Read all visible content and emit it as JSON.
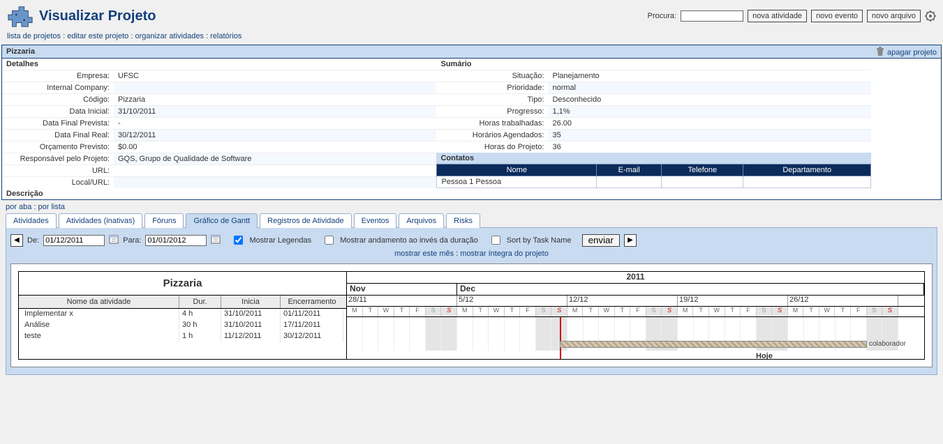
{
  "header": {
    "title": "Visualizar Projeto",
    "search_label": "Procura:",
    "new_activity": "nova atividade",
    "new_event": "novo evento",
    "new_file": "novo arquivo"
  },
  "breadcrumb": {
    "projects": "lista de projetos",
    "edit": "editar este projeto",
    "organize": "organizar atividades",
    "reports": "relatórios"
  },
  "project": {
    "name": "Pizzaria",
    "delete_label": "apagar projeto",
    "details_head": "Detalhes",
    "summary_head": "Sumário",
    "contacts_head": "Contatos",
    "description_head": "Descrição",
    "details": {
      "empresa_l": "Empresa:",
      "empresa_v": "UFSC",
      "internal_l": "Internal Company:",
      "internal_v": "",
      "codigo_l": "Código:",
      "codigo_v": "Pizzaria",
      "inicio_l": "Data Inicial:",
      "inicio_v": "31/10/2011",
      "prevista_l": "Data Final Prevista:",
      "prevista_v": "-",
      "real_l": "Data Final Real:",
      "real_v": "30/12/2011",
      "orc_l": "Orçamento Previsto:",
      "orc_v": "$0.00",
      "resp_l": "Responsável pelo Projeto:",
      "resp_v": "GQS, Grupo de Qualidade de Software",
      "url_l": "URL:",
      "url_v": "",
      "local_l": "Local/URL:",
      "local_v": ""
    },
    "summary": {
      "sit_l": "Situação:",
      "sit_v": "Planejamento",
      "pri_l": "Prioridade:",
      "pri_v": "normal",
      "tipo_l": "Tipo:",
      "tipo_v": "Desconhecido",
      "prog_l": "Progresso:",
      "prog_v": "1,1%",
      "ht_l": "Horas trabalhadas:",
      "ht_v": "26.00",
      "ha_l": "Horários Agendados:",
      "ha_v": "35",
      "hp_l": "Horas do Projeto:",
      "hp_v": "36"
    },
    "contacts_cols": {
      "name": "Nome",
      "email": "E-mail",
      "phone": "Telefone",
      "dept": "Departamento"
    },
    "contacts": [
      {
        "name": "Pessoa 1 Pessoa",
        "email": "",
        "phone": "",
        "dept": ""
      }
    ]
  },
  "subnav": {
    "by_tab": "por aba",
    "by_list": "por lista"
  },
  "tabs": {
    "atividades": "Atividades",
    "inativas": "Atividades (inativas)",
    "foruns": "Fóruns",
    "gantt": "Gráfico de Gantt",
    "registros": "Registros de Atividade",
    "eventos": "Eventos",
    "arquivos": "Arquivos",
    "risks": "Risks"
  },
  "gantt_ctrl": {
    "de": "De:",
    "de_v": "01/12/2011",
    "para": "Para:",
    "para_v": "01/01/2012",
    "legend": "Mostrar Legendas",
    "progress": "Mostrar andamento ao invés da duração",
    "sort": "Sort by Task Name",
    "send": "enviar",
    "this_month": "mostrar este mês",
    "full_project": "mostrar íntegra do projeto"
  },
  "gantt": {
    "title": "Pizzaria",
    "col_name": "Nome da atividade",
    "col_dur": "Dur.",
    "col_start": "Inicia",
    "col_end": "Encerramento",
    "year": "2011",
    "month_nov": "Nov",
    "month_dec": "Dec",
    "weeks": [
      "28/11",
      "5/12",
      "12/12",
      "19/12",
      "26/12"
    ],
    "today": "Hoje",
    "tasks": [
      {
        "name": "Implementar x",
        "dur": "4 h",
        "start": "31/10/2011",
        "end": "01/11/2011"
      },
      {
        "name": "Análise",
        "dur": "30 h",
        "start": "31/10/2011",
        "end": "17/11/2011"
      },
      {
        "name": "teste",
        "dur": "1 h",
        "start": "11/12/2011",
        "end": "30/12/2011"
      }
    ],
    "bar_label": "colaborador"
  }
}
